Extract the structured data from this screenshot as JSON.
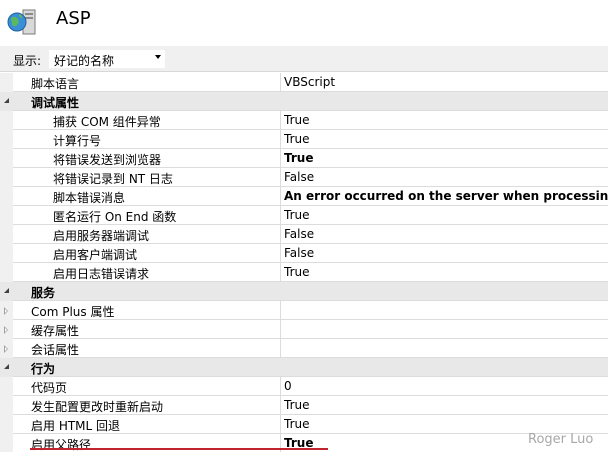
{
  "header": {
    "title": "ASP",
    "icon": "globe-server-icon"
  },
  "toolbar": {
    "display_label": "显示:",
    "display_value": "好记的名称"
  },
  "rows": [
    {
      "kind": "property",
      "level": 0,
      "name": "脚本语言",
      "value": "VBScript",
      "bold": false
    },
    {
      "kind": "category",
      "expanded": true,
      "name": "调试属性"
    },
    {
      "kind": "property",
      "level": 1,
      "name": "捕获 COM 组件异常",
      "value": "True",
      "bold": false
    },
    {
      "kind": "property",
      "level": 1,
      "name": "计算行号",
      "value": "True",
      "bold": false
    },
    {
      "kind": "property",
      "level": 1,
      "name": "将错误发送到浏览器",
      "value": "True",
      "bold": true
    },
    {
      "kind": "property",
      "level": 1,
      "name": "将错误记录到 NT 日志",
      "value": "False",
      "bold": false
    },
    {
      "kind": "property",
      "level": 1,
      "name": "脚本错误消息",
      "value": "An error occurred on the server when processing the",
      "bold": true
    },
    {
      "kind": "property",
      "level": 1,
      "name": "匿名运行 On End 函数",
      "value": "True",
      "bold": false
    },
    {
      "kind": "property",
      "level": 1,
      "name": "启用服务器端调试",
      "value": "False",
      "bold": false
    },
    {
      "kind": "property",
      "level": 1,
      "name": "启用客户端调试",
      "value": "False",
      "bold": false
    },
    {
      "kind": "property",
      "level": 1,
      "name": "启用日志错误请求",
      "value": "True",
      "bold": false
    },
    {
      "kind": "category",
      "expanded": true,
      "name": "服务"
    },
    {
      "kind": "group",
      "expanded": false,
      "name": "Com Plus 属性"
    },
    {
      "kind": "group",
      "expanded": false,
      "name": "缓存属性"
    },
    {
      "kind": "group",
      "expanded": false,
      "name": "会话属性"
    },
    {
      "kind": "category",
      "expanded": true,
      "name": "行为"
    },
    {
      "kind": "property",
      "level": 0,
      "name": "代码页",
      "value": "0",
      "bold": false
    },
    {
      "kind": "property",
      "level": 0,
      "name": "发生配置更改时重新启动",
      "value": "True",
      "bold": false
    },
    {
      "kind": "property",
      "level": 0,
      "name": "启用 HTML 回退",
      "value": "True",
      "bold": false
    },
    {
      "kind": "property",
      "level": 0,
      "name": "启用父路径",
      "value": "True",
      "bold": true
    }
  ],
  "watermark": "Roger Luo",
  "colors": {
    "highlight_underline": "#c0242c",
    "category_bg": "#e8e8e8",
    "toolbar_bg": "#f0f0f0"
  }
}
